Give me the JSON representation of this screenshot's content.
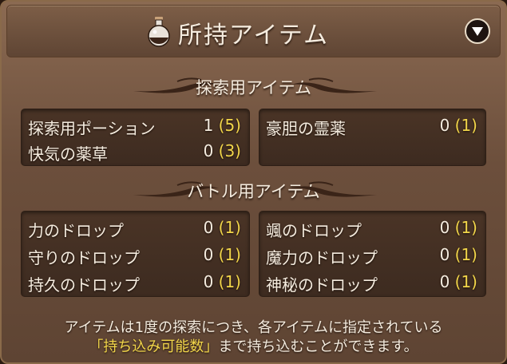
{
  "header": {
    "title": "所持アイテム",
    "potion_icon": "potion-bottle-icon",
    "toggle_icon": "chevron-down-icon"
  },
  "explore": {
    "title": "探索用アイテム",
    "left": [
      {
        "name": "探索用ポーション",
        "count": "1",
        "max": "(5)"
      },
      {
        "name": "快気の薬草",
        "count": "0",
        "max": "(3)"
      }
    ],
    "right": [
      {
        "name": "豪胆の霊薬",
        "count": "0",
        "max": "(1)"
      }
    ]
  },
  "battle": {
    "title": "バトル用アイテム",
    "left": [
      {
        "name": "力のドロップ",
        "count": "0",
        "max": "(1)"
      },
      {
        "name": "守りのドロップ",
        "count": "0",
        "max": "(1)"
      },
      {
        "name": "持久のドロップ",
        "count": "0",
        "max": "(1)"
      }
    ],
    "right": [
      {
        "name": "颯のドロップ",
        "count": "0",
        "max": "(1)"
      },
      {
        "name": "魔力のドロップ",
        "count": "0",
        "max": "(1)"
      },
      {
        "name": "神秘のドロップ",
        "count": "0",
        "max": "(1)"
      }
    ]
  },
  "footer": {
    "line1": "アイテムは1度の探索につき、各アイテムに指定されている",
    "highlight": "「持ち込み可能数」",
    "line2_rest": "まで持ち込むことができます。"
  },
  "colors": {
    "highlight": "#f2d64a",
    "text": "#f5ecdf",
    "panel": "#6c4f3c"
  }
}
